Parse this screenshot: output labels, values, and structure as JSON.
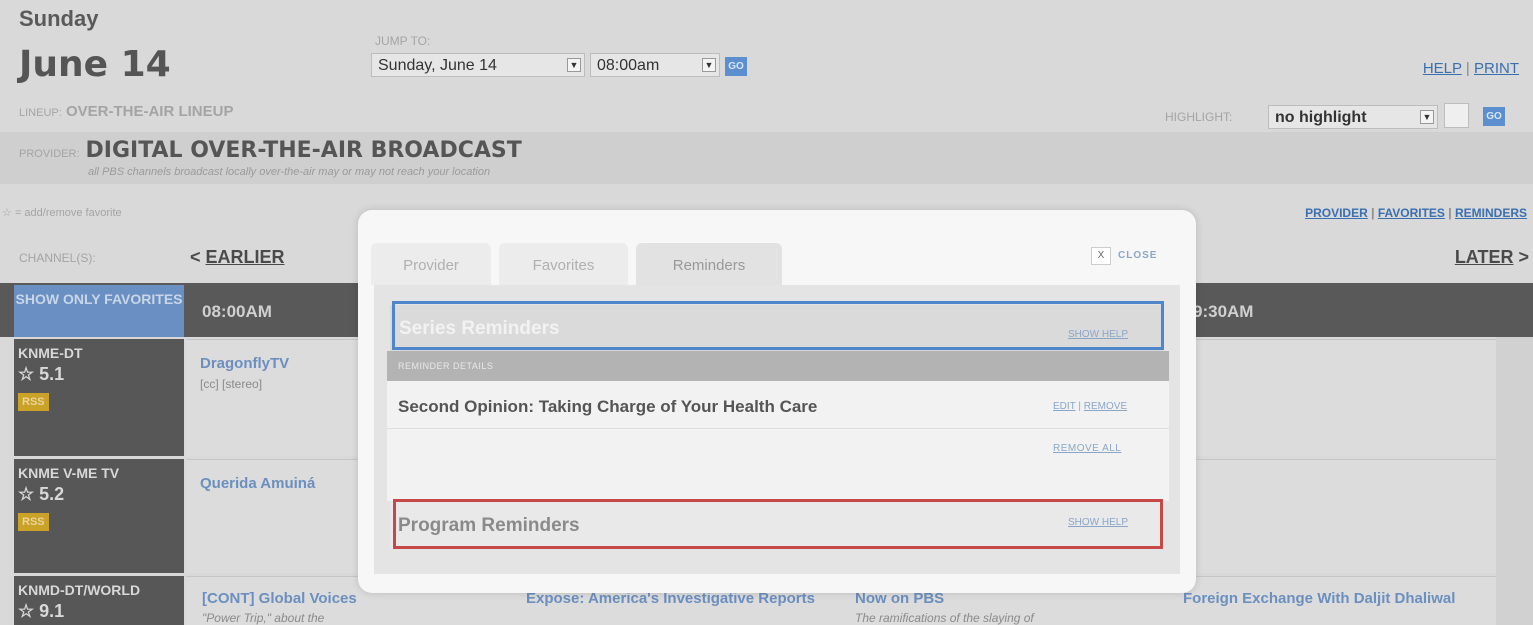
{
  "header": {
    "day": "Sunday",
    "date": "June 14",
    "jump_to_label": "JUMP TO:",
    "jump_date": "Sunday, June 14",
    "jump_time": "08:00am",
    "go": "GO",
    "help": "HELP",
    "print": "PRINT",
    "sep": "|"
  },
  "lineup": {
    "label": "LINEUP:",
    "value": "OVER-THE-AIR LINEUP"
  },
  "highlight": {
    "label": "HIGHLIGHT:",
    "value": "no highlight",
    "go": "GO"
  },
  "provider": {
    "label": "PROVIDER:",
    "value": "DIGITAL OVER-THE-AIR BROADCAST",
    "note": "all PBS channels broadcast locally over-the-air may or may not reach your location"
  },
  "favorites_hint": "= add/remove favorite",
  "view_tabs": {
    "provider": "PROVIDER",
    "favorites": "FAVORITES",
    "reminders": "REMINDERS"
  },
  "nav": {
    "channels_label": "CHANNEL(S):",
    "earlier": "EARLIER",
    "later": "LATER"
  },
  "grid": {
    "show_only_favorites": "SHOW ONLY FAVORITES",
    "times": [
      "08:00AM",
      "9:30AM"
    ],
    "channels": [
      {
        "call": "KNME-DT",
        "num": "5.1",
        "rss": "RSS"
      },
      {
        "call": "KNME V-ME TV",
        "num": "5.2",
        "rss": "RSS"
      },
      {
        "call": "KNMD-DT/WORLD",
        "num": "9.1"
      }
    ],
    "programs": {
      "dragonfly": "DragonflyTV",
      "dragonfly_sub": "[cc] [stereo]",
      "querida": "Querida Amuiná",
      "global_voices": "[CONT] Global Voices",
      "global_voices_sub": "\"Power Trip,\" about the",
      "expose": "Expose: America's Investigative Reports",
      "now_on_pbs": "Now on PBS",
      "now_on_pbs_sub": "The ramifications of the slaying of",
      "foreign_exchange": "Foreign Exchange With Daljit Dhaliwal"
    }
  },
  "modal": {
    "tabs": [
      "Provider",
      "Favorites",
      "Reminders"
    ],
    "close_x": "X",
    "close": "CLOSE",
    "series_title": "Series Reminders",
    "show_help": "SHOW HELP",
    "detail_label": "REMINDER DETAILS",
    "reminder_title": "Second Opinion: Taking Charge of Your Health Care",
    "edit": "EDIT",
    "remove": "REMOVE",
    "remove_all": "REMOVE ALL",
    "program_title": "Program Reminders"
  }
}
